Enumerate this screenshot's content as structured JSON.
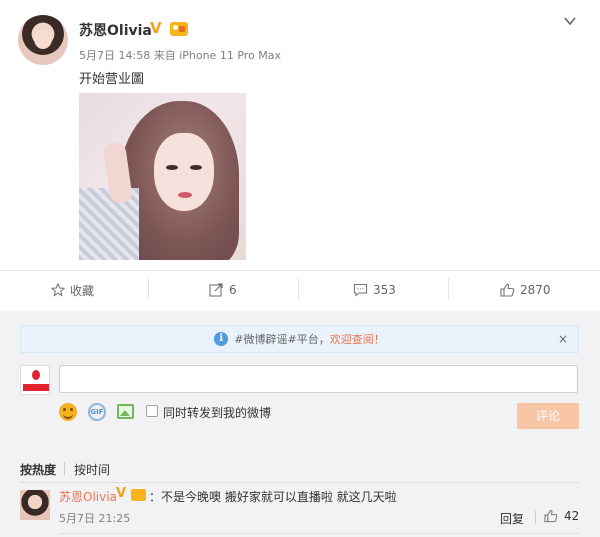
{
  "post": {
    "username": "苏恩Olivia",
    "date": "5月7日 14:58",
    "source": "来自 iPhone 11 Pro Max",
    "text": "开始营业圖"
  },
  "actions": {
    "favorite_label": "收藏",
    "forward_count": "6",
    "comment_count": "353",
    "like_count": "2870"
  },
  "notice": {
    "prefix": "#微博辟谣#平台，",
    "link_text": "欢迎查阅！",
    "close": "×"
  },
  "composer": {
    "input_value": "",
    "gif_label": "GIF",
    "forward_option": "同时转发到我的微博",
    "submit_label": "评论"
  },
  "sort": {
    "by_hot": "按热度",
    "by_time": "按时间"
  },
  "comments": [
    {
      "author": "苏恩Olivia",
      "text": "：不是今晚噢 搬好家就可以直播啦 就这几天啦",
      "time": "5月7日 21:25",
      "reply_label": "回复",
      "likes": "42"
    }
  ],
  "colors": {
    "link": "#eb7350",
    "verified": "#f4a020",
    "submit_disabled": "#f8c5a7",
    "notice_bg": "#eaf3fb"
  },
  "icons": [
    "chevron-down-icon",
    "star-icon",
    "forward-icon",
    "comment-icon",
    "thumbs-up-icon",
    "info-icon",
    "close-icon",
    "emoji-icon",
    "gif-icon",
    "image-icon"
  ]
}
